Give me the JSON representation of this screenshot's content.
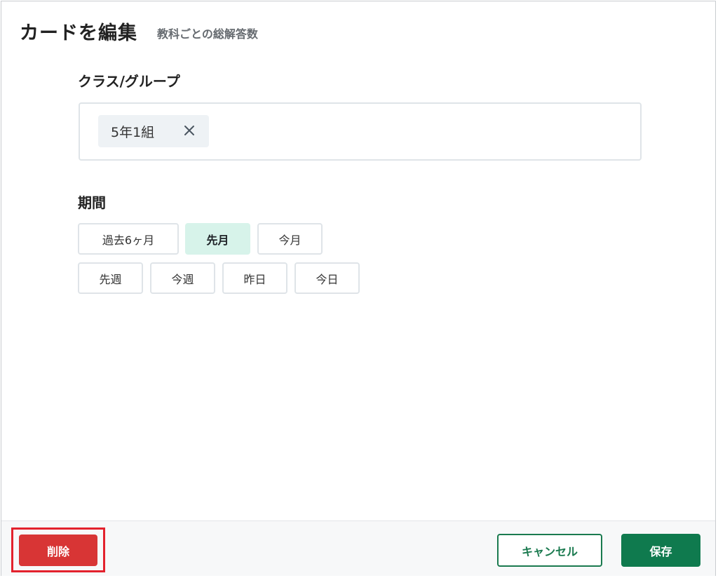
{
  "header": {
    "title": "カードを編集",
    "subtitle": "教科ごとの総解答数"
  },
  "group": {
    "label": "クラス/グループ",
    "chips": [
      {
        "label": "5年1組",
        "icon": "close-icon"
      }
    ]
  },
  "period": {
    "label": "期間",
    "selected": "先月",
    "options": [
      "過去6ヶ月",
      "先月",
      "今月",
      "先週",
      "今週",
      "昨日",
      "今日"
    ]
  },
  "footer": {
    "delete_label": "削除",
    "cancel_label": "キャンセル",
    "save_label": "保存"
  },
  "colors": {
    "accent": "#0f7a4e",
    "selected_bg": "#d7f3ea",
    "danger": "#d83535",
    "highlight_border": "#e3222d"
  }
}
